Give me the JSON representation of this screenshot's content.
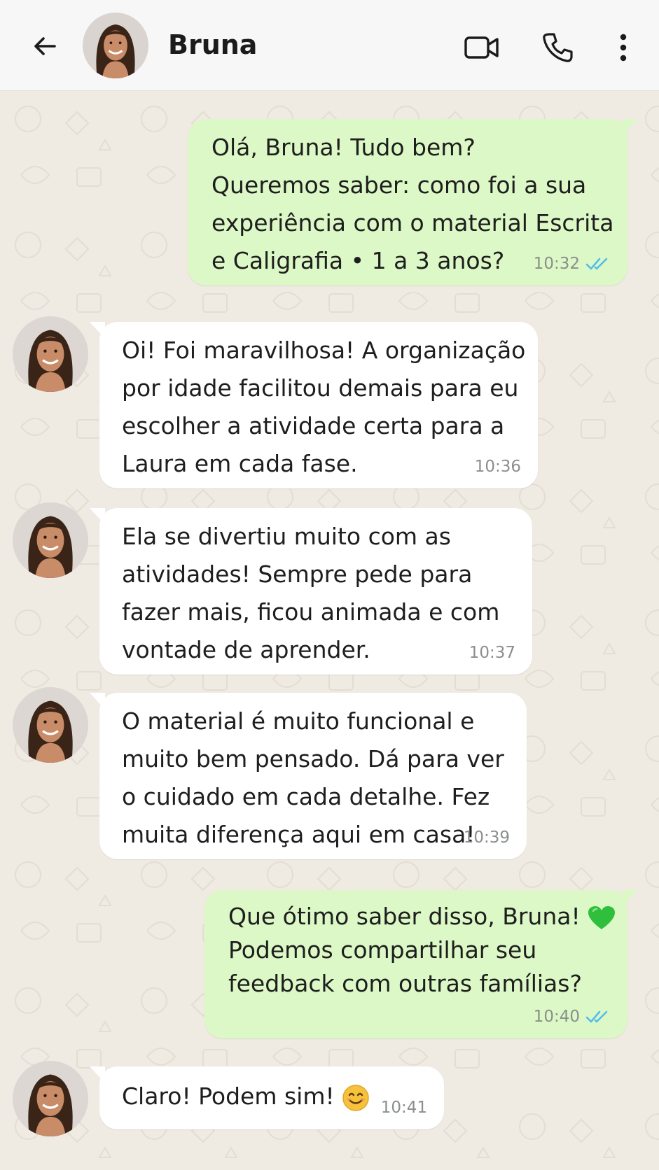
{
  "header": {
    "contact_name": "Bruna",
    "icons": [
      "back-arrow-icon",
      "avatar",
      "video-call-icon",
      "phone-icon",
      "more-options-icon"
    ]
  },
  "colors": {
    "outgoing_bubble": "#dcf8c6",
    "incoming_bubble": "#ffffff",
    "background": "#efeae2",
    "read_ticks": "#53bdeb",
    "heart": "#2fbf3c"
  },
  "messages": [
    {
      "direction": "out",
      "lines": [
        "Olá, Bruna! Tudo bem?",
        "Queremos saber: como foi a sua",
        "experiência com o material Escrita",
        "e Caligrafia • 1 a 3 anos?"
      ],
      "time": "10:32",
      "status": "read"
    },
    {
      "direction": "in",
      "lines": [
        "Oi! Foi maravilhosa! A organização",
        "por idade facilitou demais para eu",
        "escolher a atividade certa para a",
        "Laura em cada fase."
      ],
      "time": "10:36"
    },
    {
      "direction": "in",
      "lines": [
        "Ela se divertiu muito com as",
        "atividades! Sempre pede para",
        "fazer mais, ficou animada e com",
        "vontade de aprender."
      ],
      "time": "10:37"
    },
    {
      "direction": "in",
      "lines": [
        "O material é muito funcional e",
        "muito bem pensado. Dá para ver",
        "o cuidado em cada detalhe. Fez",
        "muita diferença aqui em casa!"
      ],
      "time": "10:39"
    },
    {
      "direction": "out",
      "lines": [
        "Que ótimo saber disso, Bruna!",
        "Podemos compartilhar seu",
        "feedback com outras famílias?"
      ],
      "emoji": "green-heart",
      "time": "10:40",
      "status": "read"
    },
    {
      "direction": "in",
      "lines": [
        "Claro! Podem sim!"
      ],
      "emoji": "smiling-face",
      "time": "10:41"
    }
  ]
}
